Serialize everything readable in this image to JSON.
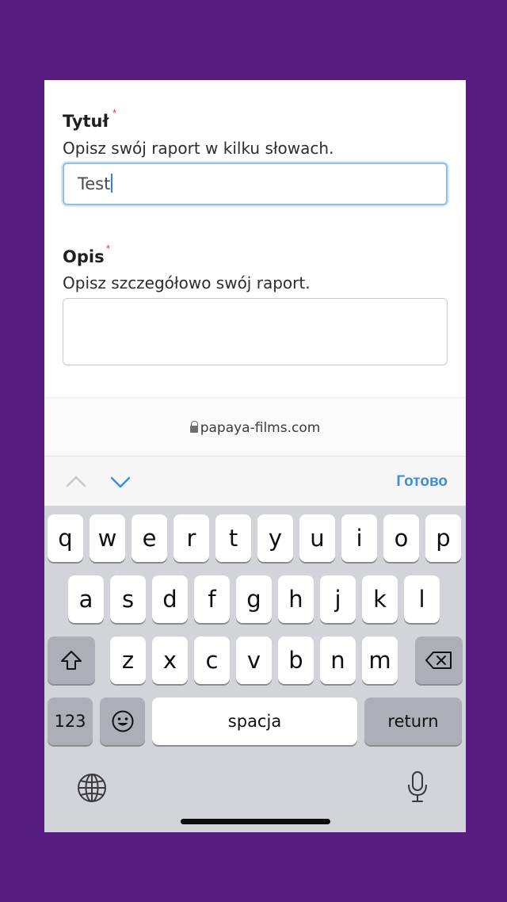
{
  "form": {
    "title_label": "Tytuł",
    "title_required": "*",
    "title_description": "Opisz swój raport w kilku słowach.",
    "title_value": "Test",
    "description_label": "Opis",
    "description_required": "*",
    "description_description": "Opisz szczegółowo swój raport.",
    "description_value": ""
  },
  "urlbar": {
    "url": "papaya-films.com"
  },
  "accessory": {
    "done_label": "Готово"
  },
  "keyboard": {
    "row1": [
      "q",
      "w",
      "e",
      "r",
      "t",
      "y",
      "u",
      "i",
      "o",
      "p"
    ],
    "row2": [
      "a",
      "s",
      "d",
      "f",
      "g",
      "h",
      "j",
      "k",
      "l"
    ],
    "row3": [
      "z",
      "x",
      "c",
      "v",
      "b",
      "n",
      "m"
    ],
    "numbers_label": "123",
    "space_label": "spacja",
    "return_label": "return"
  },
  "colors": {
    "background": "#561c80",
    "accent": "#3e8ed8",
    "required": "#d6334a"
  }
}
